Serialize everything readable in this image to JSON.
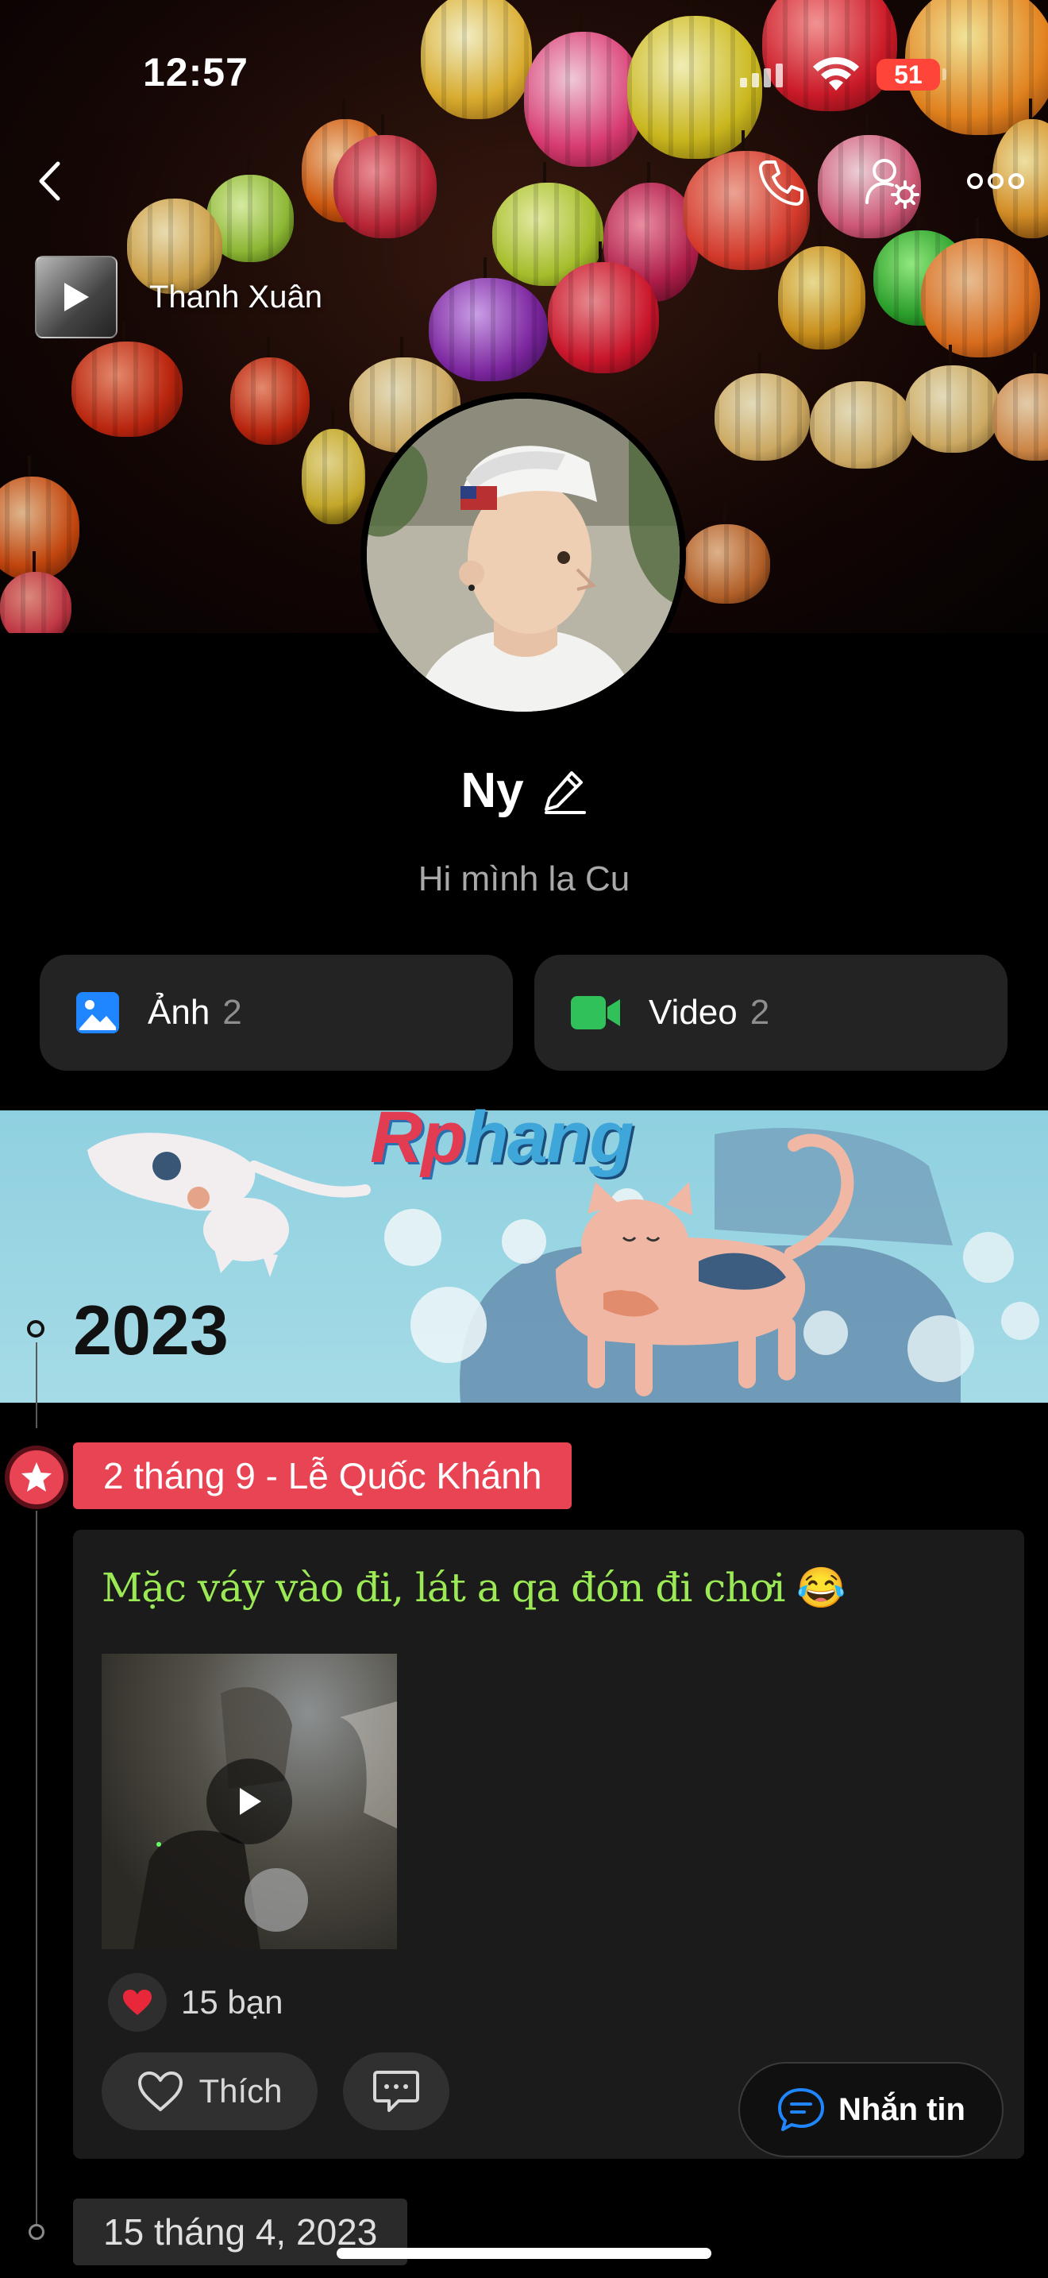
{
  "status_bar": {
    "time": "12:57",
    "battery": "51"
  },
  "header": {
    "back_icon": "chevron-left-icon",
    "call_icon": "phone-icon",
    "settings_icon": "user-settings-icon",
    "more_icon": "more-horizontal-icon"
  },
  "cover": {
    "music_title": "Thanh Xuân"
  },
  "profile": {
    "name": "Ny",
    "edit_icon": "pencil-icon",
    "bio": "Hi mình la Cu"
  },
  "media": {
    "photos": {
      "label": "Ảnh",
      "count": "2",
      "icon": "image-icon",
      "color": "#1f86ff"
    },
    "videos": {
      "label": "Video",
      "count": "2",
      "icon": "video-camera-icon",
      "color": "#30c15b"
    }
  },
  "timeline": {
    "banner_brand_a": "Rp",
    "banner_brand_b": "hang",
    "year": "2023",
    "event_tag": "2 tháng 9 - Lễ Quốc Khánh",
    "event_color": "#e94454",
    "post": {
      "text": "Mặc váy vào đi, lát a qa đón đi chơi 😂",
      "text_color": "#9bea55",
      "reaction_count": "15 bạn",
      "like_label": "Thích"
    },
    "next_date": "15 tháng 4, 2023"
  },
  "fab": {
    "label": "Nhắn tin",
    "icon": "chat-bubble-icon",
    "accent": "#1f86ff"
  }
}
